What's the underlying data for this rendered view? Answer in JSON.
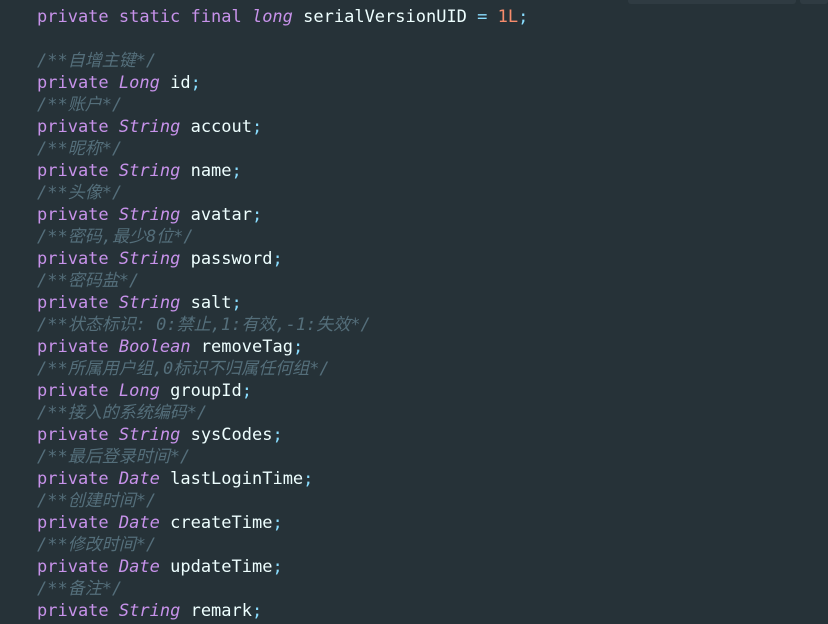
{
  "theme": {
    "background": "#263238",
    "keyword": "#c792ea",
    "identifier": "#eeffff",
    "comment": "#546e7a",
    "number": "#f78c6c",
    "operator": "#89ddff"
  },
  "code": {
    "serial": {
      "kw": "private static final",
      "type": "long",
      "name": "serialVersionUID",
      "eq": "=",
      "value": "1L",
      "semi": ";"
    },
    "fields": [
      {
        "comment": "/**自增主键*/",
        "kw": "private",
        "type": "Long",
        "name": "id",
        "semi": ";"
      },
      {
        "comment": "/**账户*/",
        "kw": "private",
        "type": "String",
        "name": "accout",
        "semi": ";"
      },
      {
        "comment": "/**昵称*/",
        "kw": "private",
        "type": "String",
        "name": "name",
        "semi": ";"
      },
      {
        "comment": "/**头像*/",
        "kw": "private",
        "type": "String",
        "name": "avatar",
        "semi": ";"
      },
      {
        "comment": "/**密码,最少8位*/",
        "kw": "private",
        "type": "String",
        "name": "password",
        "semi": ";"
      },
      {
        "comment": "/**密码盐*/",
        "kw": "private",
        "type": "String",
        "name": "salt",
        "semi": ";"
      },
      {
        "comment": "/**状态标识: 0:禁止,1:有效,-1:失效*/",
        "kw": "private",
        "type": "Boolean",
        "name": "removeTag",
        "semi": ";"
      },
      {
        "comment": "/**所属用户组,0标识不归属任何组*/",
        "kw": "private",
        "type": "Long",
        "name": "groupId",
        "semi": ";"
      },
      {
        "comment": "/**接入的系统编码*/",
        "kw": "private",
        "type": "String",
        "name": "sysCodes",
        "semi": ";"
      },
      {
        "comment": "/**最后登录时间*/",
        "kw": "private",
        "type": "Date",
        "name": "lastLoginTime",
        "semi": ";"
      },
      {
        "comment": "/**创建时间*/",
        "kw": "private",
        "type": "Date",
        "name": "createTime",
        "semi": ";"
      },
      {
        "comment": "/**修改时间*/",
        "kw": "private",
        "type": "Date",
        "name": "updateTime",
        "semi": ";"
      },
      {
        "comment": "/**备注*/",
        "kw": "private",
        "type": "String",
        "name": "remark",
        "semi": ";"
      }
    ]
  }
}
